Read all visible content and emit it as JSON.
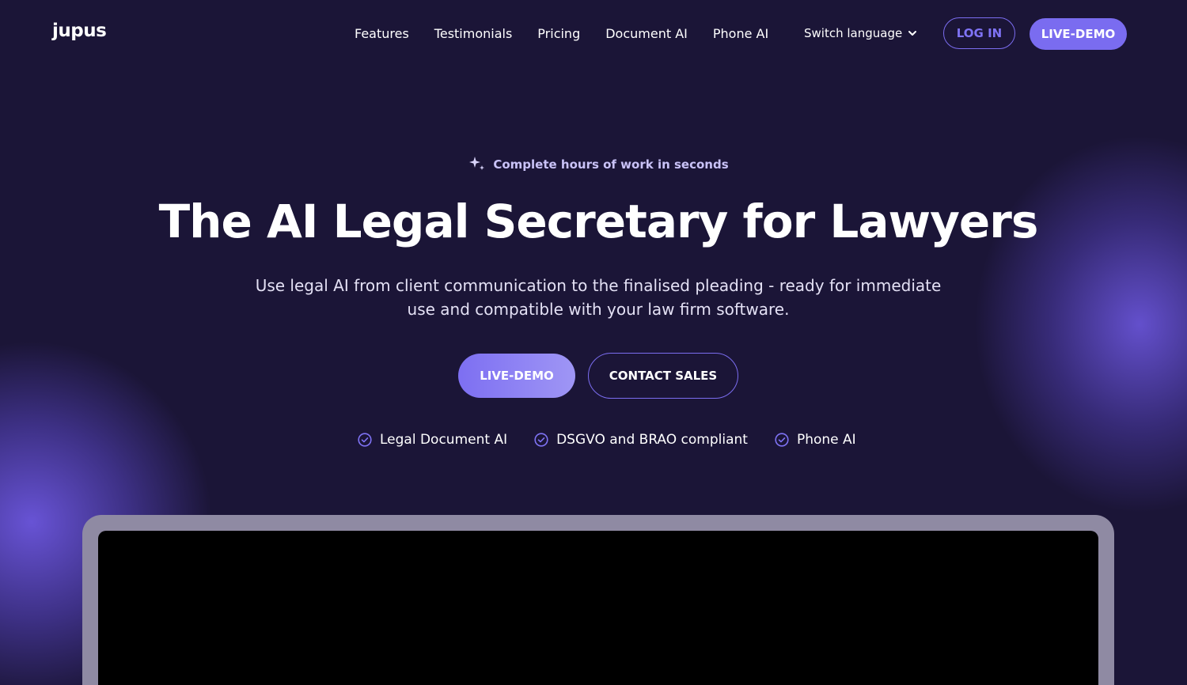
{
  "header": {
    "logo": "jupus",
    "nav": [
      "Features",
      "Testimonials",
      "Pricing",
      "Document AI",
      "Phone AI"
    ],
    "language_label": "Switch language",
    "login_label": "LOG IN",
    "demo_label": "LIVE-DEMO"
  },
  "hero": {
    "eyebrow": "Complete hours of work in seconds",
    "title": "The AI Legal Secretary for Lawyers",
    "subtitle": "Use legal AI from client communication to the finalised pleading - ready for immediate use and compatible with your law firm software.",
    "cta_primary": "LIVE-DEMO",
    "cta_secondary": "CONTACT SALES",
    "features": [
      "Legal Document AI",
      "DSGVO and BRAO compliant",
      "Phone AI"
    ]
  },
  "icons": {
    "eyebrow": "sparkle-icon",
    "language": "chevron-down-icon",
    "feature": "check-circle-icon"
  },
  "colors": {
    "background": "#1b1537",
    "accent": "#7a6cf0",
    "device_frame": "#8f8aa3",
    "screen": "#000000"
  }
}
